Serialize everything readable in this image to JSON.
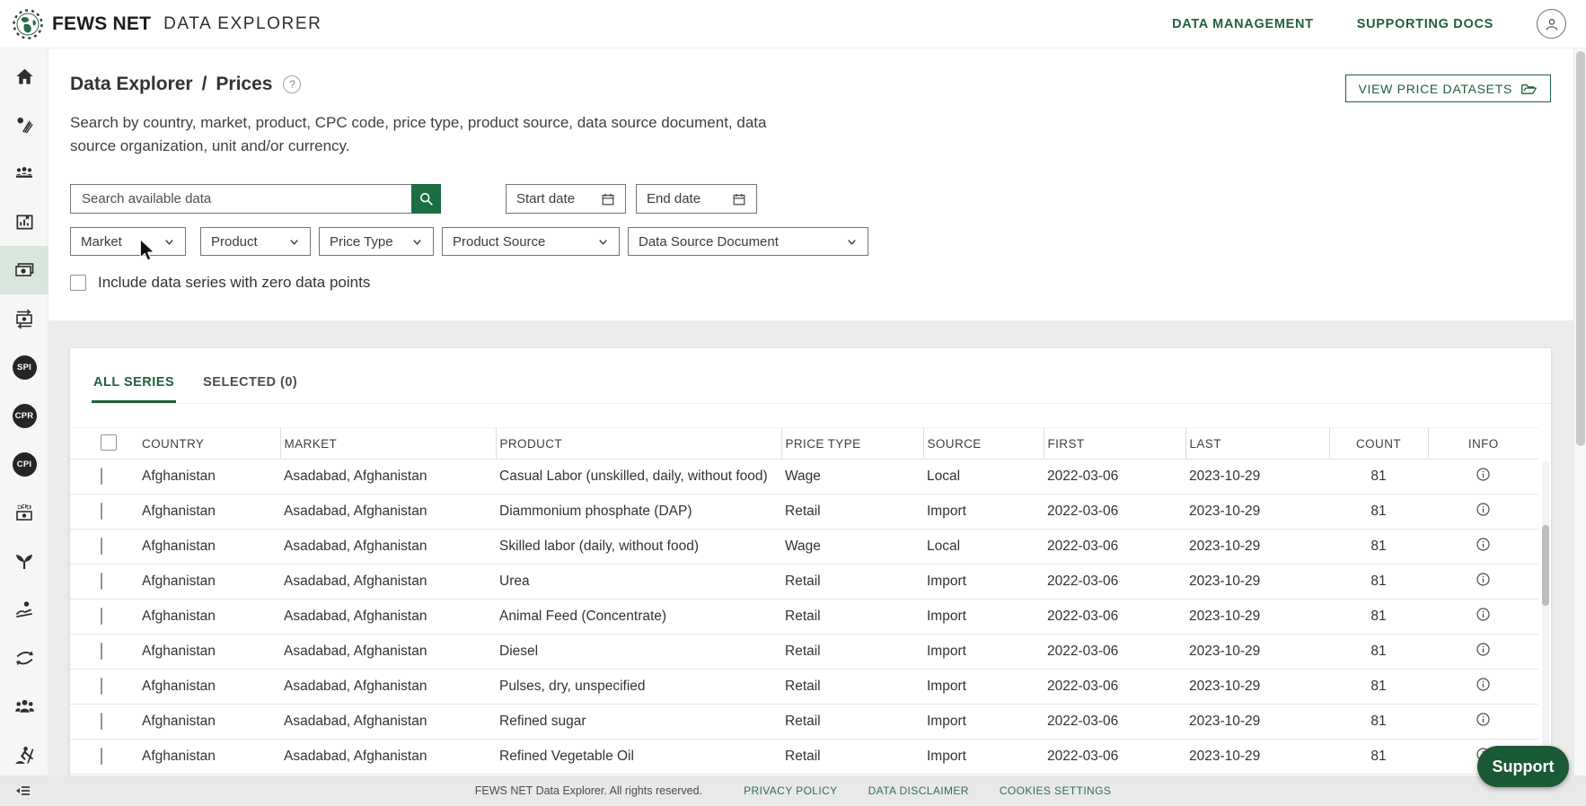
{
  "header": {
    "brand": "FEWS NET",
    "app_title": "DATA EXPLORER",
    "nav": [
      {
        "label": "DATA MANAGEMENT"
      },
      {
        "label": "SUPPORTING DOCS"
      }
    ]
  },
  "sidebar": {
    "active_item": "prices",
    "icon_names": [
      "home-icon",
      "commodity-coin-wheat-icon",
      "population-group-icon",
      "chart-board-icon",
      "prices-banknote-icon",
      "money-transfer-icon",
      "spi-icon",
      "cpr-icon",
      "cpi-icon",
      "money-coins-icon",
      "seedling-icon",
      "hand-coin-icon",
      "trade-flow-arrows-icon",
      "people-group-icon",
      "agricultural-labor-icon",
      "expand-menu-icon"
    ],
    "badges": {
      "spi": "SPI",
      "cpr": "CPR",
      "cpi": "CPI"
    }
  },
  "page": {
    "breadcrumb": {
      "root": "Data Explorer",
      "separator": "/",
      "current": "Prices"
    },
    "help_icon": "?",
    "description": "Search by country, market, product, CPC code, price type, product source, data source document, data source organization, unit and/or currency.",
    "view_datasets_button": "VIEW PRICE DATASETS"
  },
  "filters": {
    "search_placeholder": "Search available data",
    "start_date_placeholder": "Start date",
    "end_date_placeholder": "End date",
    "dropdowns": [
      "Market",
      "Product",
      "Price Type",
      "Product Source",
      "Data Source Document"
    ],
    "zero_data_checkbox_label": "Include data series with zero data points",
    "zero_data_checked": false
  },
  "tabs": {
    "all": "ALL SERIES",
    "selected": "SELECTED (0)",
    "active": "ALL SERIES"
  },
  "table": {
    "columns": [
      "COUNTRY",
      "MARKET",
      "PRODUCT",
      "PRICE TYPE",
      "SOURCE",
      "FIRST",
      "LAST",
      "COUNT",
      "INFO"
    ],
    "rows": [
      {
        "country": "Afghanistan",
        "market": "Asadabad, Afghanistan",
        "product": "Casual Labor (unskilled, daily, without food)",
        "price_type": "Wage",
        "source": "Local",
        "first": "2022-03-06",
        "last": "2023-10-29",
        "count": "81"
      },
      {
        "country": "Afghanistan",
        "market": "Asadabad, Afghanistan",
        "product": "Diammonium phosphate (DAP)",
        "price_type": "Retail",
        "source": "Import",
        "first": "2022-03-06",
        "last": "2023-10-29",
        "count": "81"
      },
      {
        "country": "Afghanistan",
        "market": "Asadabad, Afghanistan",
        "product": "Skilled labor (daily, without food)",
        "price_type": "Wage",
        "source": "Local",
        "first": "2022-03-06",
        "last": "2023-10-29",
        "count": "81"
      },
      {
        "country": "Afghanistan",
        "market": "Asadabad, Afghanistan",
        "product": "Urea",
        "price_type": "Retail",
        "source": "Import",
        "first": "2022-03-06",
        "last": "2023-10-29",
        "count": "81"
      },
      {
        "country": "Afghanistan",
        "market": "Asadabad, Afghanistan",
        "product": "Animal Feed (Concentrate)",
        "price_type": "Retail",
        "source": "Import",
        "first": "2022-03-06",
        "last": "2023-10-29",
        "count": "81"
      },
      {
        "country": "Afghanistan",
        "market": "Asadabad, Afghanistan",
        "product": "Diesel",
        "price_type": "Retail",
        "source": "Import",
        "first": "2022-03-06",
        "last": "2023-10-29",
        "count": "81"
      },
      {
        "country": "Afghanistan",
        "market": "Asadabad, Afghanistan",
        "product": "Pulses, dry, unspecified",
        "price_type": "Retail",
        "source": "Import",
        "first": "2022-03-06",
        "last": "2023-10-29",
        "count": "81"
      },
      {
        "country": "Afghanistan",
        "market": "Asadabad, Afghanistan",
        "product": "Refined sugar",
        "price_type": "Retail",
        "source": "Import",
        "first": "2022-03-06",
        "last": "2023-10-29",
        "count": "81"
      },
      {
        "country": "Afghanistan",
        "market": "Asadabad, Afghanistan",
        "product": "Refined Vegetable Oil",
        "price_type": "Retail",
        "source": "Import",
        "first": "2022-03-06",
        "last": "2023-10-29",
        "count": "81"
      }
    ]
  },
  "footer": {
    "copyright": "FEWS NET Data Explorer. All rights reserved.",
    "links": [
      "PRIVACY POLICY",
      "DATA DISCLAIMER",
      "COOKIES SETTINGS"
    ]
  },
  "support_button": "Support",
  "colors": {
    "brand_green": "#21603F",
    "search_button_green": "#1D6E42",
    "support_green": "#1A5A34",
    "active_sidebar_bg": "#D8E7DE",
    "gray_band": "#ECECEC",
    "footer_bg": "#E9E9E9",
    "link_green": "#2D7050"
  }
}
